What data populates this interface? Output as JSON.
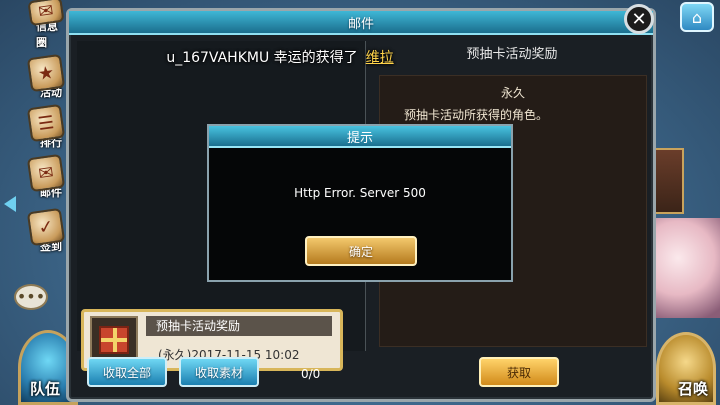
{
  "side_menu": {
    "items": [
      {
        "label": "信息圈",
        "icon": "info-icon"
      },
      {
        "label": "活动",
        "icon": "event-icon"
      },
      {
        "label": "排行",
        "icon": "ranking-icon"
      },
      {
        "label": "邮件",
        "icon": "mail-icon"
      },
      {
        "label": "签到",
        "icon": "checkin-icon"
      }
    ],
    "team_label": "队伍"
  },
  "right_menu": {
    "summon_label": "召唤",
    "home_icon": "home-icon"
  },
  "mail": {
    "title": "邮件",
    "notification": {
      "prefix": "u_167VAHKMU 幸运的获得了",
      "name": "维拉"
    },
    "detail": {
      "title": "预抽卡活动奖励",
      "duration": "永久",
      "description": "预抽卡活动所获得的角色。"
    },
    "items": [
      {
        "title": "预抽卡活动奖励",
        "date": "(永久)2017-11-15  10:02"
      }
    ],
    "buttons": {
      "collect_all": "收取全部",
      "collect_material": "收取素材",
      "count": "0/0",
      "obtain": "获取"
    }
  },
  "dialog": {
    "title": "提示",
    "message": "Http Error. Server 500",
    "confirm": "确定"
  },
  "colors": {
    "header_blue": "#3fb7d6",
    "accent_gold": "#d8b65a",
    "highlight_name": "#ffd34a"
  }
}
